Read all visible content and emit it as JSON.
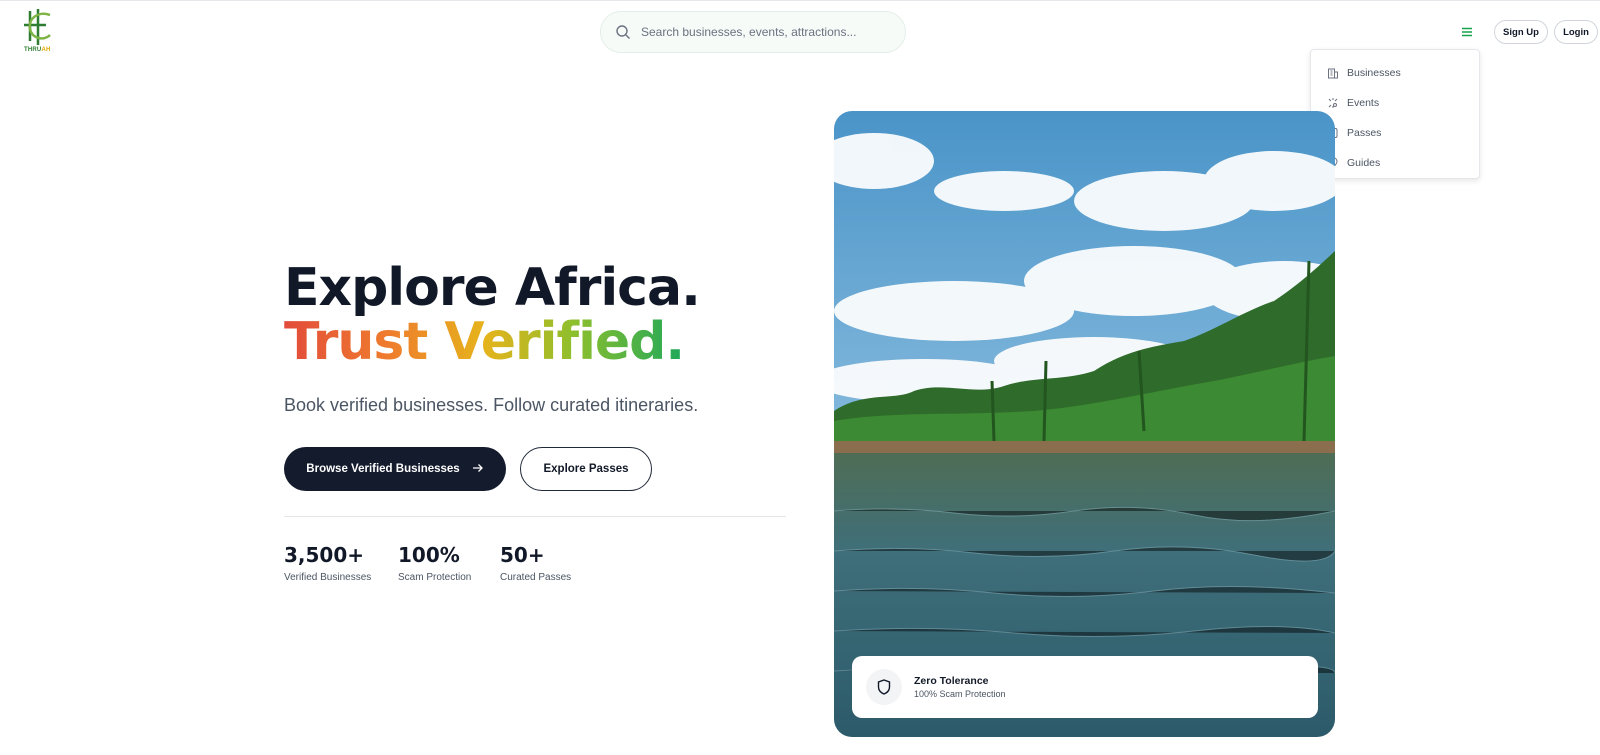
{
  "header": {
    "logo_text": "THRU",
    "logo_text_accent": "AH",
    "search_placeholder": "Search businesses, events, attractions...",
    "signup_label": "Sign Up",
    "login_label": "Login"
  },
  "menu": {
    "items": [
      {
        "label": "Businesses",
        "icon": "building-icon"
      },
      {
        "label": "Events",
        "icon": "sparkle-icon"
      },
      {
        "label": "Passes",
        "icon": "ticket-icon"
      },
      {
        "label": "Guides",
        "icon": "map-pin-icon"
      }
    ]
  },
  "hero": {
    "title_line1": "Explore Africa.",
    "title_line2": "Trust Verified.",
    "subtitle": "Book verified businesses. Follow curated itineraries.",
    "primary_cta": "Browse Verified Businesses",
    "secondary_cta": "Explore Passes"
  },
  "stats": [
    {
      "value": "3,500+",
      "label": "Verified Businesses"
    },
    {
      "value": "100%",
      "label": "Scam Protection"
    },
    {
      "value": "50+",
      "label": "Curated Passes"
    }
  ],
  "badge": {
    "title": "Zero Tolerance",
    "subtitle": "100% Scam Protection"
  },
  "colors": {
    "brand_green": "#2e7d32",
    "primary_dark": "#141b2d",
    "gradient": [
      "#e24b3b",
      "#ef7a2e",
      "#e6b31c",
      "#8fbf2c",
      "#1ea85a"
    ]
  }
}
